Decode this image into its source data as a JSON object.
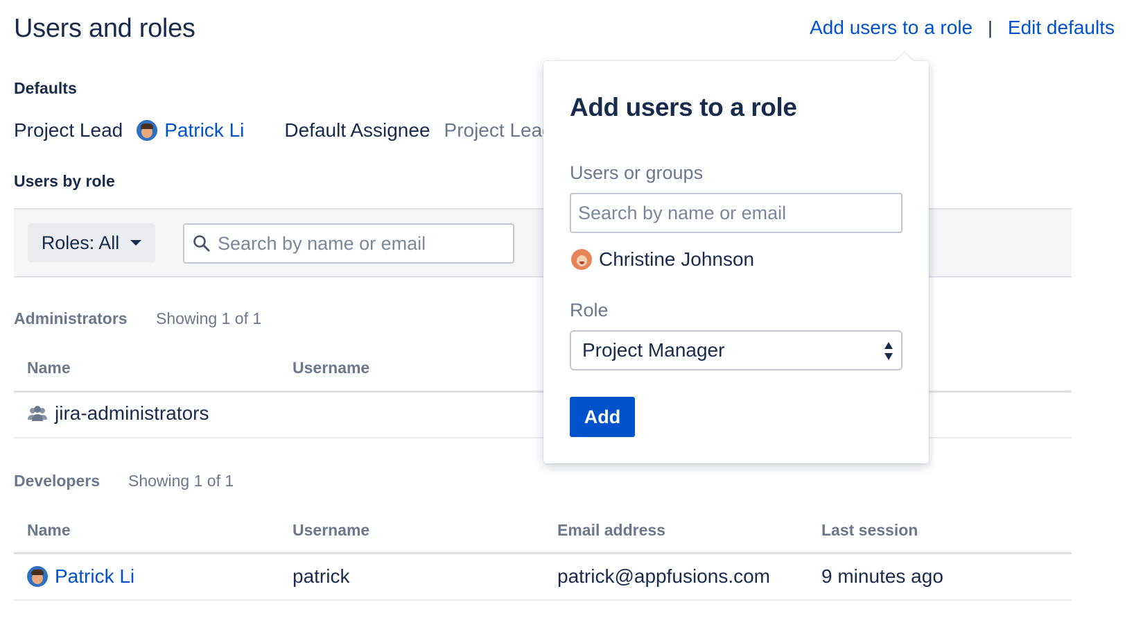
{
  "header": {
    "title": "Users and roles",
    "add_users_link": "Add users to a role",
    "separator": "|",
    "edit_defaults_link": "Edit defaults"
  },
  "defaults": {
    "heading": "Defaults",
    "project_lead_label": "Project Lead",
    "project_lead_value": "Patrick Li",
    "default_assignee_label": "Default Assignee",
    "default_assignee_value": "Project Lead"
  },
  "users_by_role": {
    "heading": "Users by role",
    "roles_filter_label": "Roles: All",
    "search_placeholder": "Search by name or email"
  },
  "groups": [
    {
      "title": "Administrators",
      "count": "Showing 1 of 1",
      "columns": [
        "Name",
        "Username"
      ],
      "rows": [
        {
          "name": "jira-administrators",
          "icon": "group-icon"
        }
      ]
    },
    {
      "title": "Developers",
      "count": "Showing 1 of 1",
      "columns": [
        "Name",
        "Username",
        "Email address",
        "Last session"
      ],
      "rows": [
        {
          "name": "Patrick Li",
          "username": "patrick",
          "email": "patrick@appfusions.com",
          "last_session": "9 minutes ago",
          "icon": "avatar"
        }
      ]
    }
  ],
  "popover": {
    "title": "Add users to a role",
    "users_label": "Users or groups",
    "users_placeholder": "Search by name or email",
    "selected_user": "Christine Johnson",
    "role_label": "Role",
    "role_value": "Project Manager",
    "add_button": "Add"
  },
  "colors": {
    "link": "#0052cc",
    "primary_button": "#0052cc",
    "text": "#172b4d",
    "subtle_text": "#6b778c",
    "filter_bar_bg": "#f4f5f7"
  }
}
